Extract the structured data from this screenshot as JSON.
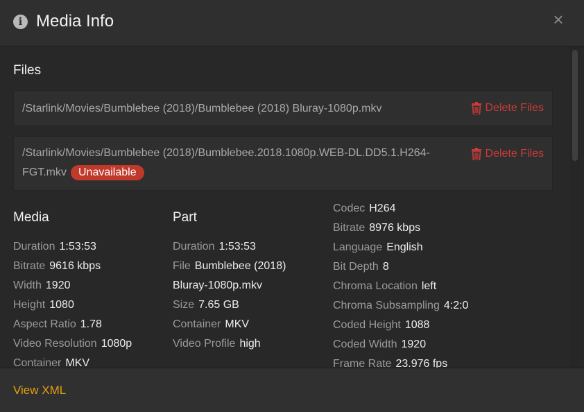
{
  "header": {
    "title": "Media Info",
    "info_icon": "info-circle-icon",
    "close_icon": "close-icon",
    "close_glyph": "×"
  },
  "files": {
    "title": "Files",
    "items": [
      {
        "path": "/Starlink/Movies/Bumblebee (2018)/Bumblebee (2018) Bluray-1080p.mkv",
        "delete_label": "Delete Files",
        "badge": ""
      },
      {
        "path": "/Starlink/Movies/Bumblebee (2018)/Bumblebee.2018.1080p.WEB-DL.DD5.1.H264-FGT.mkv",
        "delete_label": "Delete Files",
        "badge": "Unavailable"
      }
    ]
  },
  "media": {
    "title": "Media",
    "rows": [
      {
        "label": "Duration",
        "value": "1:53:53"
      },
      {
        "label": "Bitrate",
        "value": "9616 kbps"
      },
      {
        "label": "Width",
        "value": "1920"
      },
      {
        "label": "Height",
        "value": "1080"
      },
      {
        "label": "Aspect Ratio",
        "value": "1.78"
      },
      {
        "label": "Video Resolution",
        "value": "1080p"
      },
      {
        "label": "Container",
        "value": "MKV"
      }
    ]
  },
  "part": {
    "title": "Part",
    "rows": [
      {
        "label": "Duration",
        "value": "1:53:53"
      },
      {
        "label": "File",
        "value": "Bumblebee (2018)"
      },
      {
        "label": "",
        "value": "Bluray-1080p.mkv"
      },
      {
        "label": "Size",
        "value": "7.65 GB"
      },
      {
        "label": "Container",
        "value": "MKV"
      },
      {
        "label": "Video Profile",
        "value": "high"
      }
    ]
  },
  "stream": {
    "rows": [
      {
        "label": "Codec",
        "value": "H264"
      },
      {
        "label": "Bitrate",
        "value": "8976 kbps"
      },
      {
        "label": "Language",
        "value": "English"
      },
      {
        "label": "Bit Depth",
        "value": "8"
      },
      {
        "label": "Chroma Location",
        "value": "left"
      },
      {
        "label": "Chroma Subsampling",
        "value": "4:2:0"
      },
      {
        "label": "Coded Height",
        "value": "1088"
      },
      {
        "label": "Coded Width",
        "value": "1920"
      },
      {
        "label": "Frame Rate",
        "value": "23.976 fps"
      }
    ]
  },
  "footer": {
    "view_xml": "View XML"
  },
  "colors": {
    "accent": "#e5a00d",
    "danger": "#cc3a3a",
    "badge": "#c0392b"
  }
}
